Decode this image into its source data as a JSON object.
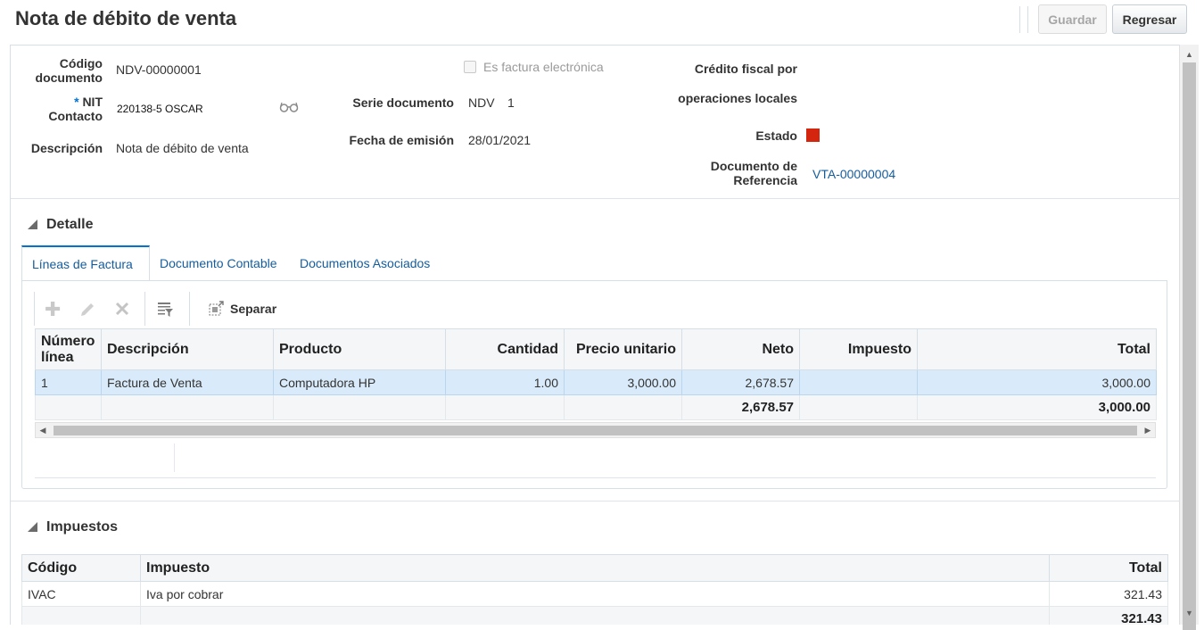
{
  "page": {
    "title": "Nota de débito de venta",
    "buttons": {
      "save": "Guardar",
      "back": "Regresar"
    }
  },
  "header": {
    "codigo_label": "Código documento",
    "codigo_value": "NDV-00000001",
    "nit_required": "*",
    "nit_label": "NIT Contacto",
    "nit_value": "220138-5 OSCAR",
    "descripcion_label": "Descripción",
    "descripcion_value": "Nota de débito de venta",
    "factura_electronica_label": "Es factura electrónica",
    "factura_electronica_checked": false,
    "serie_label": "Serie documento",
    "serie_value": "NDV",
    "serie_number": "1",
    "fecha_label": "Fecha de emisión",
    "fecha_value": "28/01/2021",
    "credito_label_1": "Crédito fiscal por",
    "credito_label_2": "operaciones locales",
    "estado_label": "Estado",
    "estado_color": "#d4260f",
    "docref_label": "Documento de Referencia",
    "docref_value": "VTA-00000004"
  },
  "detalle": {
    "title": "Detalle",
    "tabs": [
      "Líneas de Factura",
      "Documento Contable",
      "Documentos Asociados"
    ],
    "toolbar": {
      "add_icon": "plus-icon",
      "edit_icon": "pencil-icon",
      "delete_icon": "x-icon",
      "filter_icon": "filter-icon",
      "separar": "Separar"
    },
    "columns": [
      "Número línea",
      "Descripción",
      "Producto",
      "Cantidad",
      "Precio unitario",
      "Neto",
      "Impuesto",
      "Total"
    ],
    "rows": [
      [
        "1",
        "Factura de Venta",
        "Computadora HP",
        "1.00",
        "3,000.00",
        "2,678.57",
        "",
        "3,000.00"
      ]
    ],
    "totals": {
      "neto": "2,678.57",
      "total": "3,000.00"
    }
  },
  "impuestos": {
    "title": "Impuestos",
    "columns": [
      "Código",
      "Impuesto",
      "Total"
    ],
    "rows": [
      [
        "IVAC",
        "Iva por cobrar",
        "321.43"
      ]
    ],
    "total": "321.43"
  }
}
